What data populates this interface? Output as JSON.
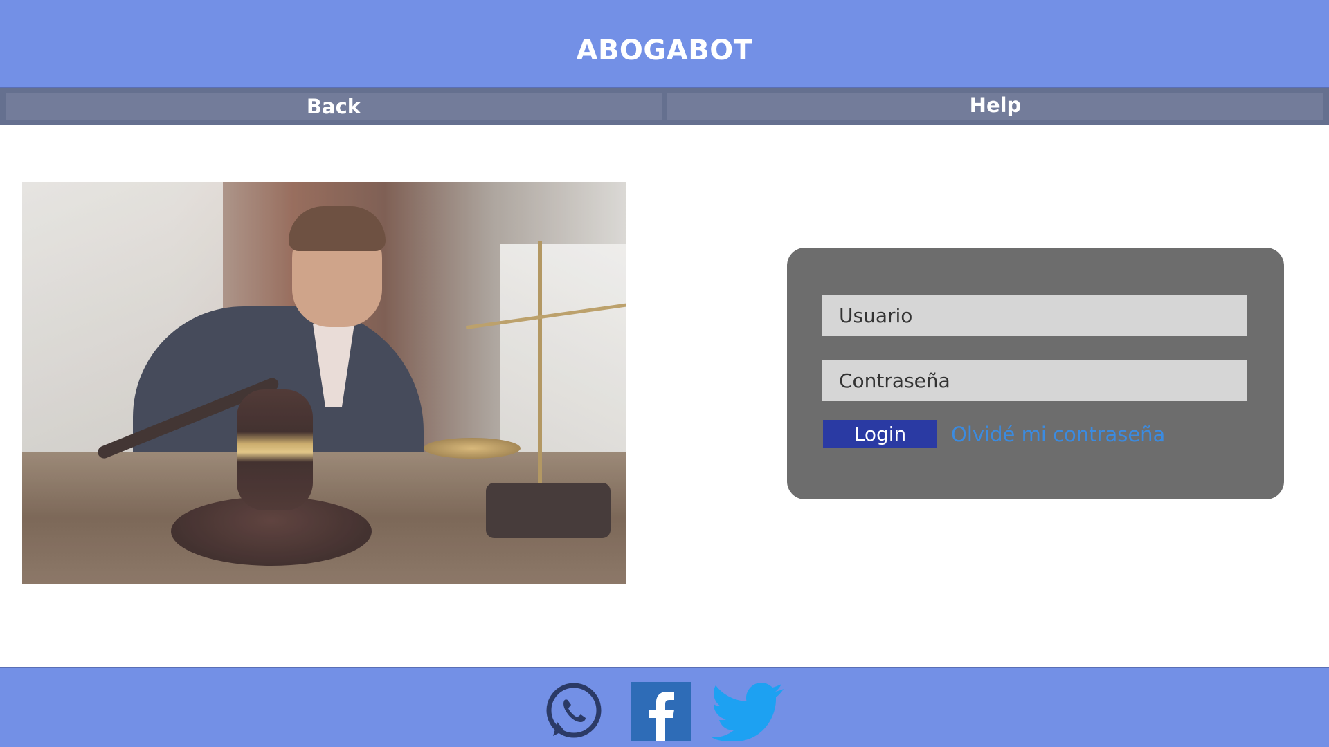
{
  "header": {
    "title": "ABOGABOT"
  },
  "nav": {
    "back_label": "Back",
    "help_label": "Help"
  },
  "login": {
    "username_placeholder": "Usuario",
    "password_placeholder": "Contraseña",
    "login_label": "Login",
    "forgot_label": "Olvidé mi contraseña"
  },
  "footer": {
    "social": [
      {
        "icon": "whatsapp-icon"
      },
      {
        "icon": "facebook-icon"
      },
      {
        "icon": "twitter-icon"
      }
    ]
  },
  "colors": {
    "header_bg": "#7390e6",
    "nav_bg": "#737c9a",
    "card_bg": "#6d6d6d",
    "login_button": "#2a3aa3",
    "link": "#3b8be0",
    "facebook": "#2e6cb7",
    "twitter": "#1da1f2",
    "whatsapp": "#2b3a66"
  }
}
